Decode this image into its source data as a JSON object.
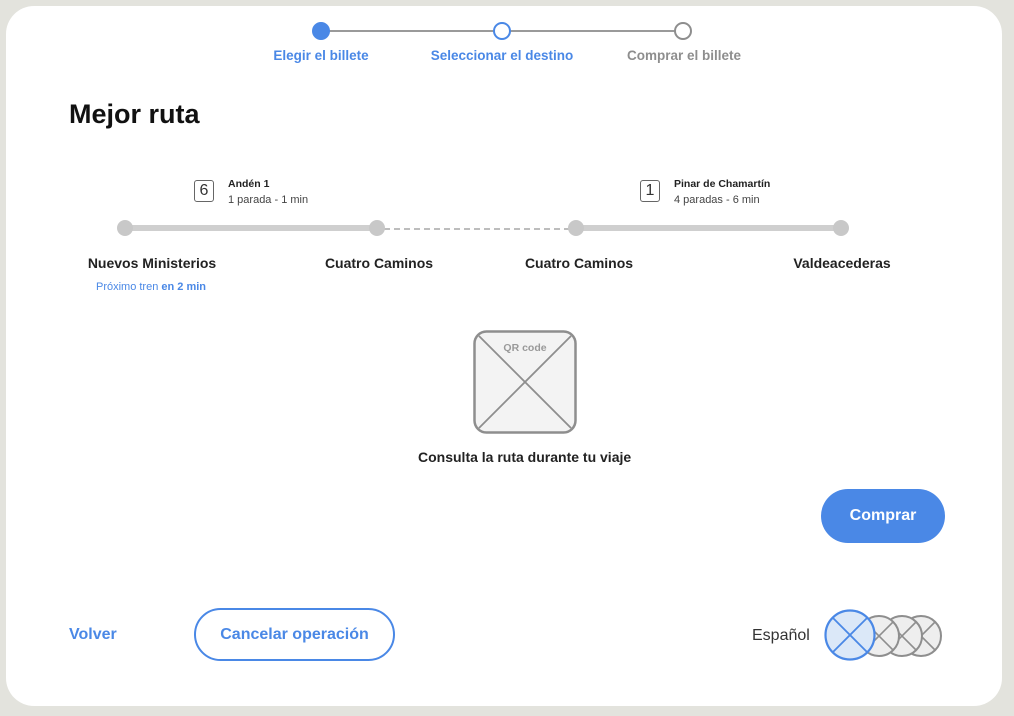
{
  "stepper": {
    "steps": [
      {
        "label": "Elegir el billete",
        "state": "done"
      },
      {
        "label": "Seleccionar el destino",
        "state": "current"
      },
      {
        "label": "Comprar el billete",
        "state": "pending"
      }
    ]
  },
  "page": {
    "title": "Mejor ruta"
  },
  "route": {
    "legs": [
      {
        "line": "6",
        "platform": "Andén 1",
        "summary": "1 parada - 1 min"
      },
      {
        "line": "1",
        "platform": "Pinar de Chamartín",
        "summary": "4 paradas - 6 min"
      }
    ],
    "stops": [
      "Nuevos Ministerios",
      "Cuatro Caminos",
      "Cuatro Caminos",
      "Valdeacederas"
    ],
    "next_train": {
      "prefix": "Próximo tren",
      "value": "en 2 min"
    }
  },
  "qr": {
    "placeholder_label": "QR code",
    "caption": "Consulta la ruta durante tu viaje"
  },
  "actions": {
    "buy_label": "Comprar",
    "back_label": "Volver",
    "cancel_label": "Cancelar operación"
  },
  "language": {
    "current": "Español",
    "flag_icons": [
      "flag-icon-selected",
      "flag-icon",
      "flag-icon",
      "flag-icon"
    ]
  },
  "colors": {
    "accent": "#4a88e6",
    "muted": "#8e8e8e",
    "route": "#cfcfcf"
  }
}
